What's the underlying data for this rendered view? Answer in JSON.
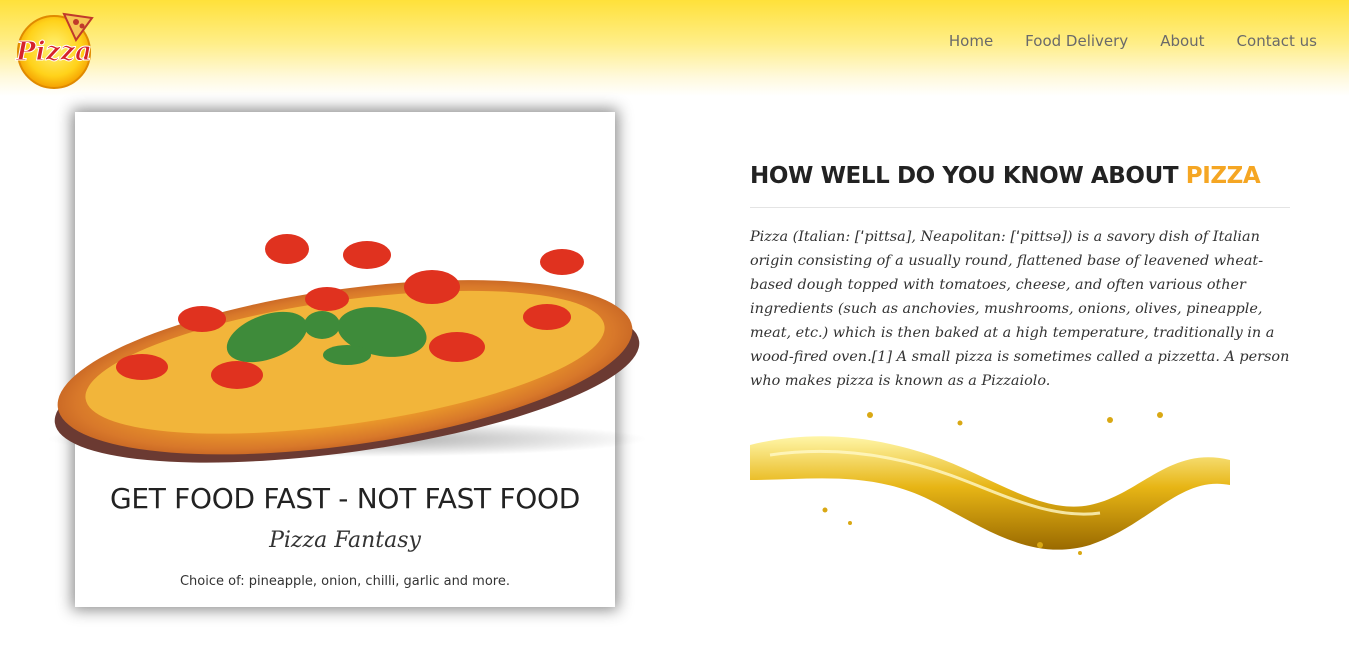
{
  "logo": {
    "text": "Pizza"
  },
  "nav": {
    "items": [
      "Home",
      "Food Delivery",
      "About",
      "Contact us"
    ]
  },
  "card": {
    "title": "GET FOOD FAST - NOT FAST FOOD",
    "subtitle": "Pizza Fantasy",
    "text": "Choice of: pineapple, onion, chilli, garlic and more."
  },
  "about": {
    "heading_prefix": "HOW WELL DO YOU KNOW ABOUT ",
    "heading_accent": "PIZZA",
    "body": "Pizza (Italian: [ˈpittsa], Neapolitan: [ˈpittsə]) is a savory dish of Italian origin consisting of a usually round, flattened base of leavened wheat-based dough topped with tomatoes, cheese, and often various other ingredients (such as anchovies, mushrooms, onions, olives, pineapple, meat, etc.) which is then baked at a high temperature, traditionally in a wood-fired oven.[1] A small pizza is sometimes called a pizzetta. A person who makes pizza is known as a Pizzaiolo."
  },
  "colors": {
    "header_yellow": "#ffe13a",
    "accent": "#f5a623",
    "text": "#222222"
  }
}
